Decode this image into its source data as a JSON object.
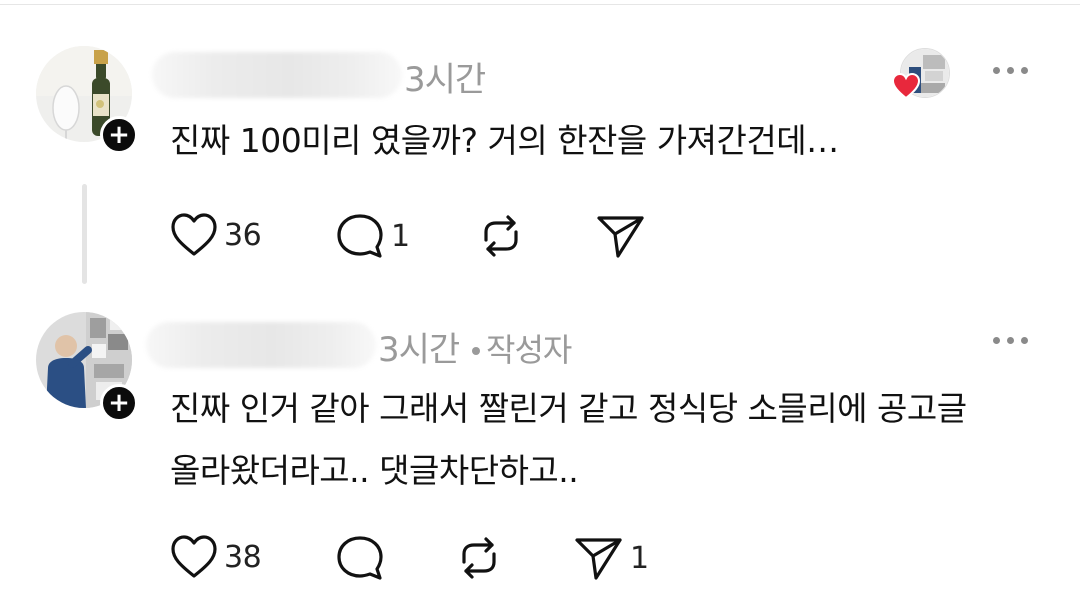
{
  "colors": {
    "text": "#111111",
    "meta": "#9a9a9a",
    "heart_red": "#e8283c",
    "badge": "#0b0b0b"
  },
  "comments": [
    {
      "time": "3시간",
      "text": "진짜 100미리 였을까? 거의 한잔을 가져간건데…",
      "likes": "36",
      "replies": "1",
      "shares": "",
      "avatar_icon": "champagne-bottle-avatar",
      "liked_by_author": true
    },
    {
      "time": "3시간",
      "author_tag": "작성자",
      "text_line1": "진짜 인거 같아 그래서 짤린거 같고 정식당 소믈리에 공고글",
      "text_line2": "올라왔더라고.. 댓글차단하고..",
      "likes": "38",
      "replies": "",
      "shares": "1",
      "avatar_icon": "person-avatar"
    }
  ]
}
